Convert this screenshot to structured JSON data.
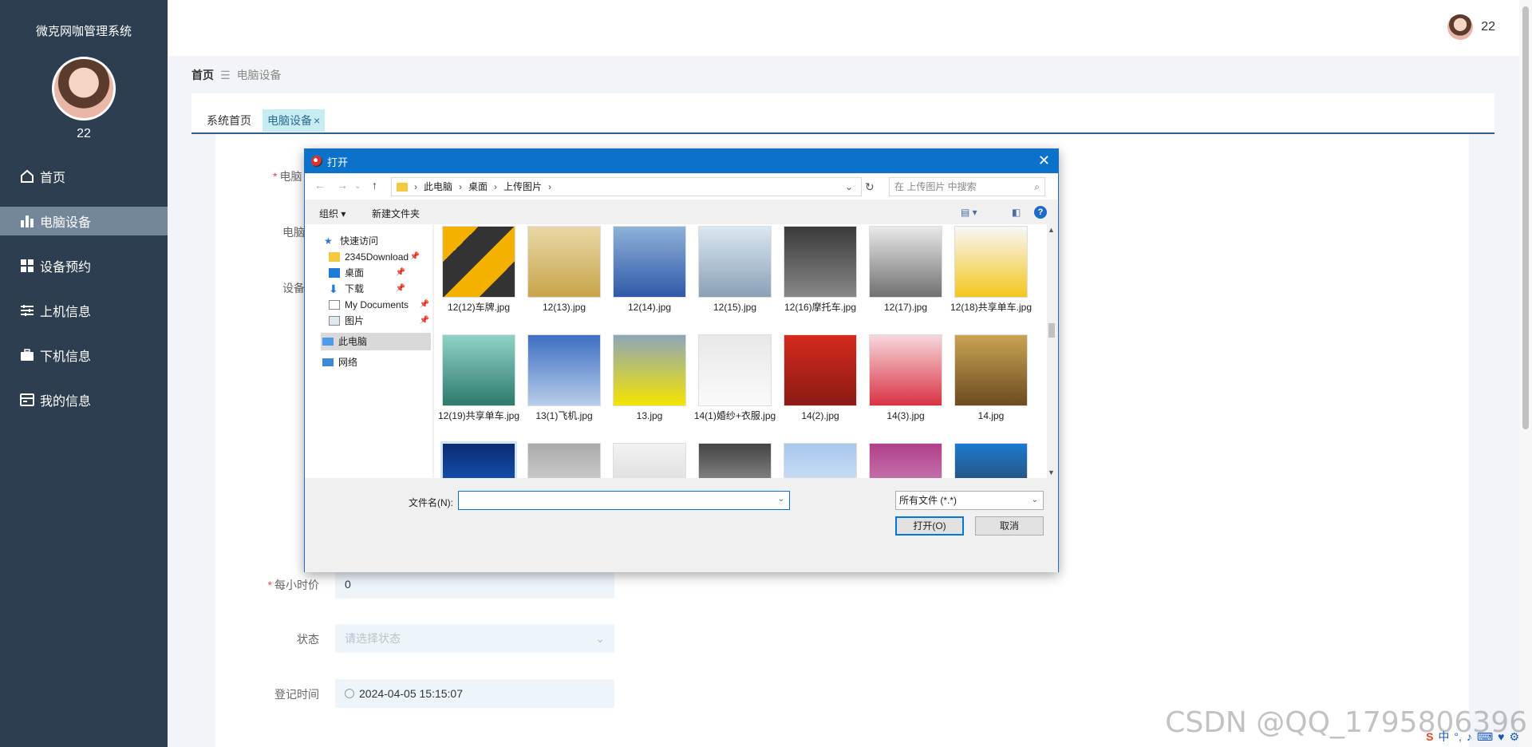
{
  "sidebar": {
    "title": "微克网咖管理系统",
    "username": "22",
    "menu": [
      {
        "label": "首页",
        "icon": "home-icon"
      },
      {
        "label": "电脑设备",
        "icon": "bar-chart-icon"
      },
      {
        "label": "设备预约",
        "icon": "grid-icon"
      },
      {
        "label": "上机信息",
        "icon": "sliders-icon"
      },
      {
        "label": "下机信息",
        "icon": "briefcase-icon"
      },
      {
        "label": "我的信息",
        "icon": "card-icon"
      }
    ]
  },
  "topbar": {
    "username": "22"
  },
  "breadcrumb": {
    "home": "首页",
    "separator": "☰",
    "current": "电脑设备"
  },
  "tabs": [
    {
      "label": "系统首页"
    },
    {
      "label": "电脑设备",
      "close": "×"
    }
  ],
  "form": {
    "label_computer_name": "电脑",
    "label_computer_no": "电脑",
    "label_device": "设备",
    "required_mark": "*",
    "hourly_price_label": "每小时价",
    "hourly_price_value": "0",
    "status_label": "状态",
    "status_placeholder": "请选择状态",
    "register_time_label": "登记时间",
    "register_time_value": "2024-04-05 15:15:07"
  },
  "dialog": {
    "title": "打开",
    "address": [
      "此电脑",
      "桌面",
      "上传图片"
    ],
    "search_placeholder": "在 上传图片 中搜索",
    "organize": "组织 ▾",
    "new_folder": "新建文件夹",
    "help": "?",
    "nav": [
      {
        "label": "快速访问",
        "pinned": false
      },
      {
        "label": "2345Download",
        "pinned": true
      },
      {
        "label": "桌面",
        "pinned": true
      },
      {
        "label": "下载",
        "pinned": true
      },
      {
        "label": "My Documents",
        "pinned": true
      },
      {
        "label": "图片",
        "pinned": true
      },
      {
        "label": "此电脑",
        "pinned": false
      },
      {
        "label": "网络",
        "pinned": false
      }
    ],
    "files": [
      {
        "name": "12(12)车牌.jpg"
      },
      {
        "name": "12(13).jpg"
      },
      {
        "name": "12(14).jpg"
      },
      {
        "name": "12(15).jpg"
      },
      {
        "name": "12(16)摩托车.jpg"
      },
      {
        "name": "12(17).jpg"
      },
      {
        "name": "12(18)共享单车.jpg"
      },
      {
        "name": "12(19)共享单车.jpg"
      },
      {
        "name": "13(1)飞机.jpg"
      },
      {
        "name": "13.jpg"
      },
      {
        "name": "14(1)婚纱+衣服.jpg"
      },
      {
        "name": "14(2).jpg"
      },
      {
        "name": "14(3).jpg"
      },
      {
        "name": "14.jpg"
      },
      {
        "name": ""
      },
      {
        "name": ""
      },
      {
        "name": ""
      },
      {
        "name": ""
      },
      {
        "name": ""
      },
      {
        "name": ""
      },
      {
        "name": ""
      }
    ],
    "filename_label": "文件名(N):",
    "filename_value": "",
    "filetype": "所有文件 (*.*)",
    "open_button": "打开(O)",
    "cancel_button": "取消"
  },
  "watermark": "CSDN @QQ_1795806396",
  "colors": {
    "sidebar": "#2c3e50",
    "active_menu": "#74879a",
    "tab_active": "#c7ecf1",
    "dialog_title": "#0b72cc"
  }
}
